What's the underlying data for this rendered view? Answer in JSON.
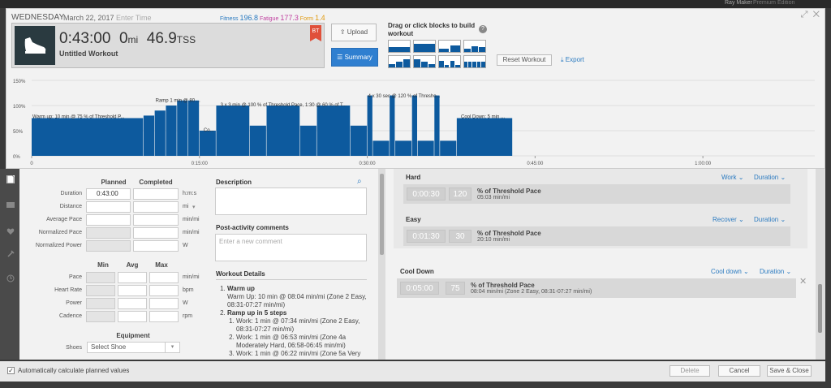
{
  "topbar": {
    "user": "Ray Maker",
    "account": "Premium Edition"
  },
  "header": {
    "day": "WEDNESDAY",
    "date": "March 22, 2017",
    "time_placeholder": "Enter Time",
    "fitness_label": "Fitness",
    "fitness_value": "196.8",
    "fatigue_label": "Fatigue",
    "fatigue_value": "177.3",
    "form_label": "Form",
    "form_value": "1.4"
  },
  "summary": {
    "duration": "0:43:00",
    "distance": "0",
    "distance_unit": "mi",
    "tss": "46.9",
    "tss_unit": "TSS",
    "name": "Untitled Workout",
    "badge": "BT",
    "shoe_icon": "running-shoe-icon"
  },
  "buttons": {
    "upload": "Upload",
    "summary": "Summary",
    "reset": "Reset Workout",
    "export": "Export"
  },
  "builder": {
    "drag_title": "Drag or click blocks to build workout",
    "help": "?"
  },
  "chart_data": {
    "type": "area",
    "yticks": [
      "150%",
      "100%",
      "50%",
      "0%"
    ],
    "xticks": [
      "0",
      "0:15:00",
      "0:30:00",
      "0:45:00",
      "1:00:00"
    ],
    "segment_labels": [
      "Warm up: 10 min @ 75 % of Threshold P...",
      "Ramp 1 min @ 80 ...",
      "Co...",
      "3 x 3 min @ 100 % of Threshold Pace, 1:30 @ 60 % of T...",
      "4 x 30 sec @ 120 % of Thresho...",
      "Cool Down: 5 min ..."
    ],
    "segments": [
      {
        "start": 0,
        "end": 10,
        "value": 75
      },
      {
        "start": 10,
        "end": 11,
        "value": 80
      },
      {
        "start": 11,
        "end": 12,
        "value": 90
      },
      {
        "start": 12,
        "end": 13,
        "value": 100
      },
      {
        "start": 13,
        "end": 14,
        "value": 110
      },
      {
        "start": 14,
        "end": 15,
        "value": 110
      },
      {
        "start": 15,
        "end": 16.5,
        "value": 50
      },
      {
        "start": 16.5,
        "end": 19.5,
        "value": 100
      },
      {
        "start": 19.5,
        "end": 21,
        "value": 60
      },
      {
        "start": 21,
        "end": 24,
        "value": 100
      },
      {
        "start": 24,
        "end": 25.5,
        "value": 60
      },
      {
        "start": 25.5,
        "end": 28.5,
        "value": 100
      },
      {
        "start": 28.5,
        "end": 30,
        "value": 60
      },
      {
        "start": 30,
        "end": 30.5,
        "value": 120
      },
      {
        "start": 30.5,
        "end": 32,
        "value": 30
      },
      {
        "start": 32,
        "end": 32.5,
        "value": 120
      },
      {
        "start": 32.5,
        "end": 34,
        "value": 30
      },
      {
        "start": 34,
        "end": 34.5,
        "value": 120
      },
      {
        "start": 34.5,
        "end": 36,
        "value": 30
      },
      {
        "start": 36,
        "end": 36.5,
        "value": 120
      },
      {
        "start": 36.5,
        "end": 38,
        "value": 30
      },
      {
        "start": 38,
        "end": 43,
        "value": 75
      }
    ],
    "ylim": [
      0,
      150
    ],
    "xlim": [
      0,
      70
    ],
    "fill_color": "#0d5a9e"
  },
  "form": {
    "planned": "Planned",
    "completed": "Completed",
    "rows": [
      {
        "label": "Duration",
        "planned": "0:43:00",
        "unit": "h:m:s"
      },
      {
        "label": "Distance",
        "planned": "",
        "unit": "mi"
      },
      {
        "label": "Average Pace",
        "planned": "",
        "unit": "min/mi"
      },
      {
        "label": "Normalized Pace",
        "planned": "",
        "unit": "min/mi"
      },
      {
        "label": "Normalized Power",
        "planned": "",
        "unit": "W"
      }
    ],
    "min": "Min",
    "avg": "Avg",
    "max": "Max",
    "rows2": [
      {
        "label": "Pace",
        "unit": "min/mi"
      },
      {
        "label": "Heart Rate",
        "unit": "bpm"
      },
      {
        "label": "Power",
        "unit": "W"
      },
      {
        "label": "Cadence",
        "unit": "rpm"
      }
    ],
    "equipment": "Equipment",
    "shoes_label": "Shoes",
    "shoes_value": "Select Shoe"
  },
  "desc": {
    "description": "Description",
    "post_comments": "Post-activity comments",
    "comment_placeholder": "Enter a new comment",
    "workout_details": "Workout Details"
  },
  "details": {
    "i1_title": "Warm up",
    "i1_text": "Warm Up: 10 min @ 08:04 min/mi (Zone 2 Easy, 08:31-07:27 min/mi)",
    "i2_title": "Ramp up in 5 steps",
    "i2_s1": "Work: 1 min @ 07:34 min/mi (Zone 2 Easy, 08:31-07:27 min/mi)",
    "i2_s2": "Work: 1 min @ 06:53 min/mi (Zone 4a Moderately Hard, 06:58-06:45 min/mi)",
    "i2_s3": "Work: 1 min @ 06:22 min/mi (Zone 5a Very"
  },
  "steps": {
    "hard": {
      "title": "Hard",
      "dd1": "Work",
      "dd2": "Duration",
      "time": "0:00:30",
      "pct": "120",
      "desc": "% of Threshold Pace",
      "sub": "05:03 min/mi"
    },
    "easy": {
      "title": "Easy",
      "dd1": "Recover",
      "dd2": "Duration",
      "time": "0:01:30",
      "pct": "30",
      "desc": "% of Threshold Pace",
      "sub": "20:10 min/mi"
    },
    "cool": {
      "title": "Cool Down",
      "dd1": "Cool down",
      "dd2": "Duration",
      "time": "0:05:00",
      "pct": "75",
      "desc": "% of Threshold Pace",
      "sub": "08:04 min/mi (Zone 2 Easy, 08:31-07:27 min/mi)"
    }
  },
  "footer": {
    "auto_calc": "Automatically calculate planned values",
    "delete": "Delete",
    "cancel": "Cancel",
    "save": "Save & Close"
  }
}
